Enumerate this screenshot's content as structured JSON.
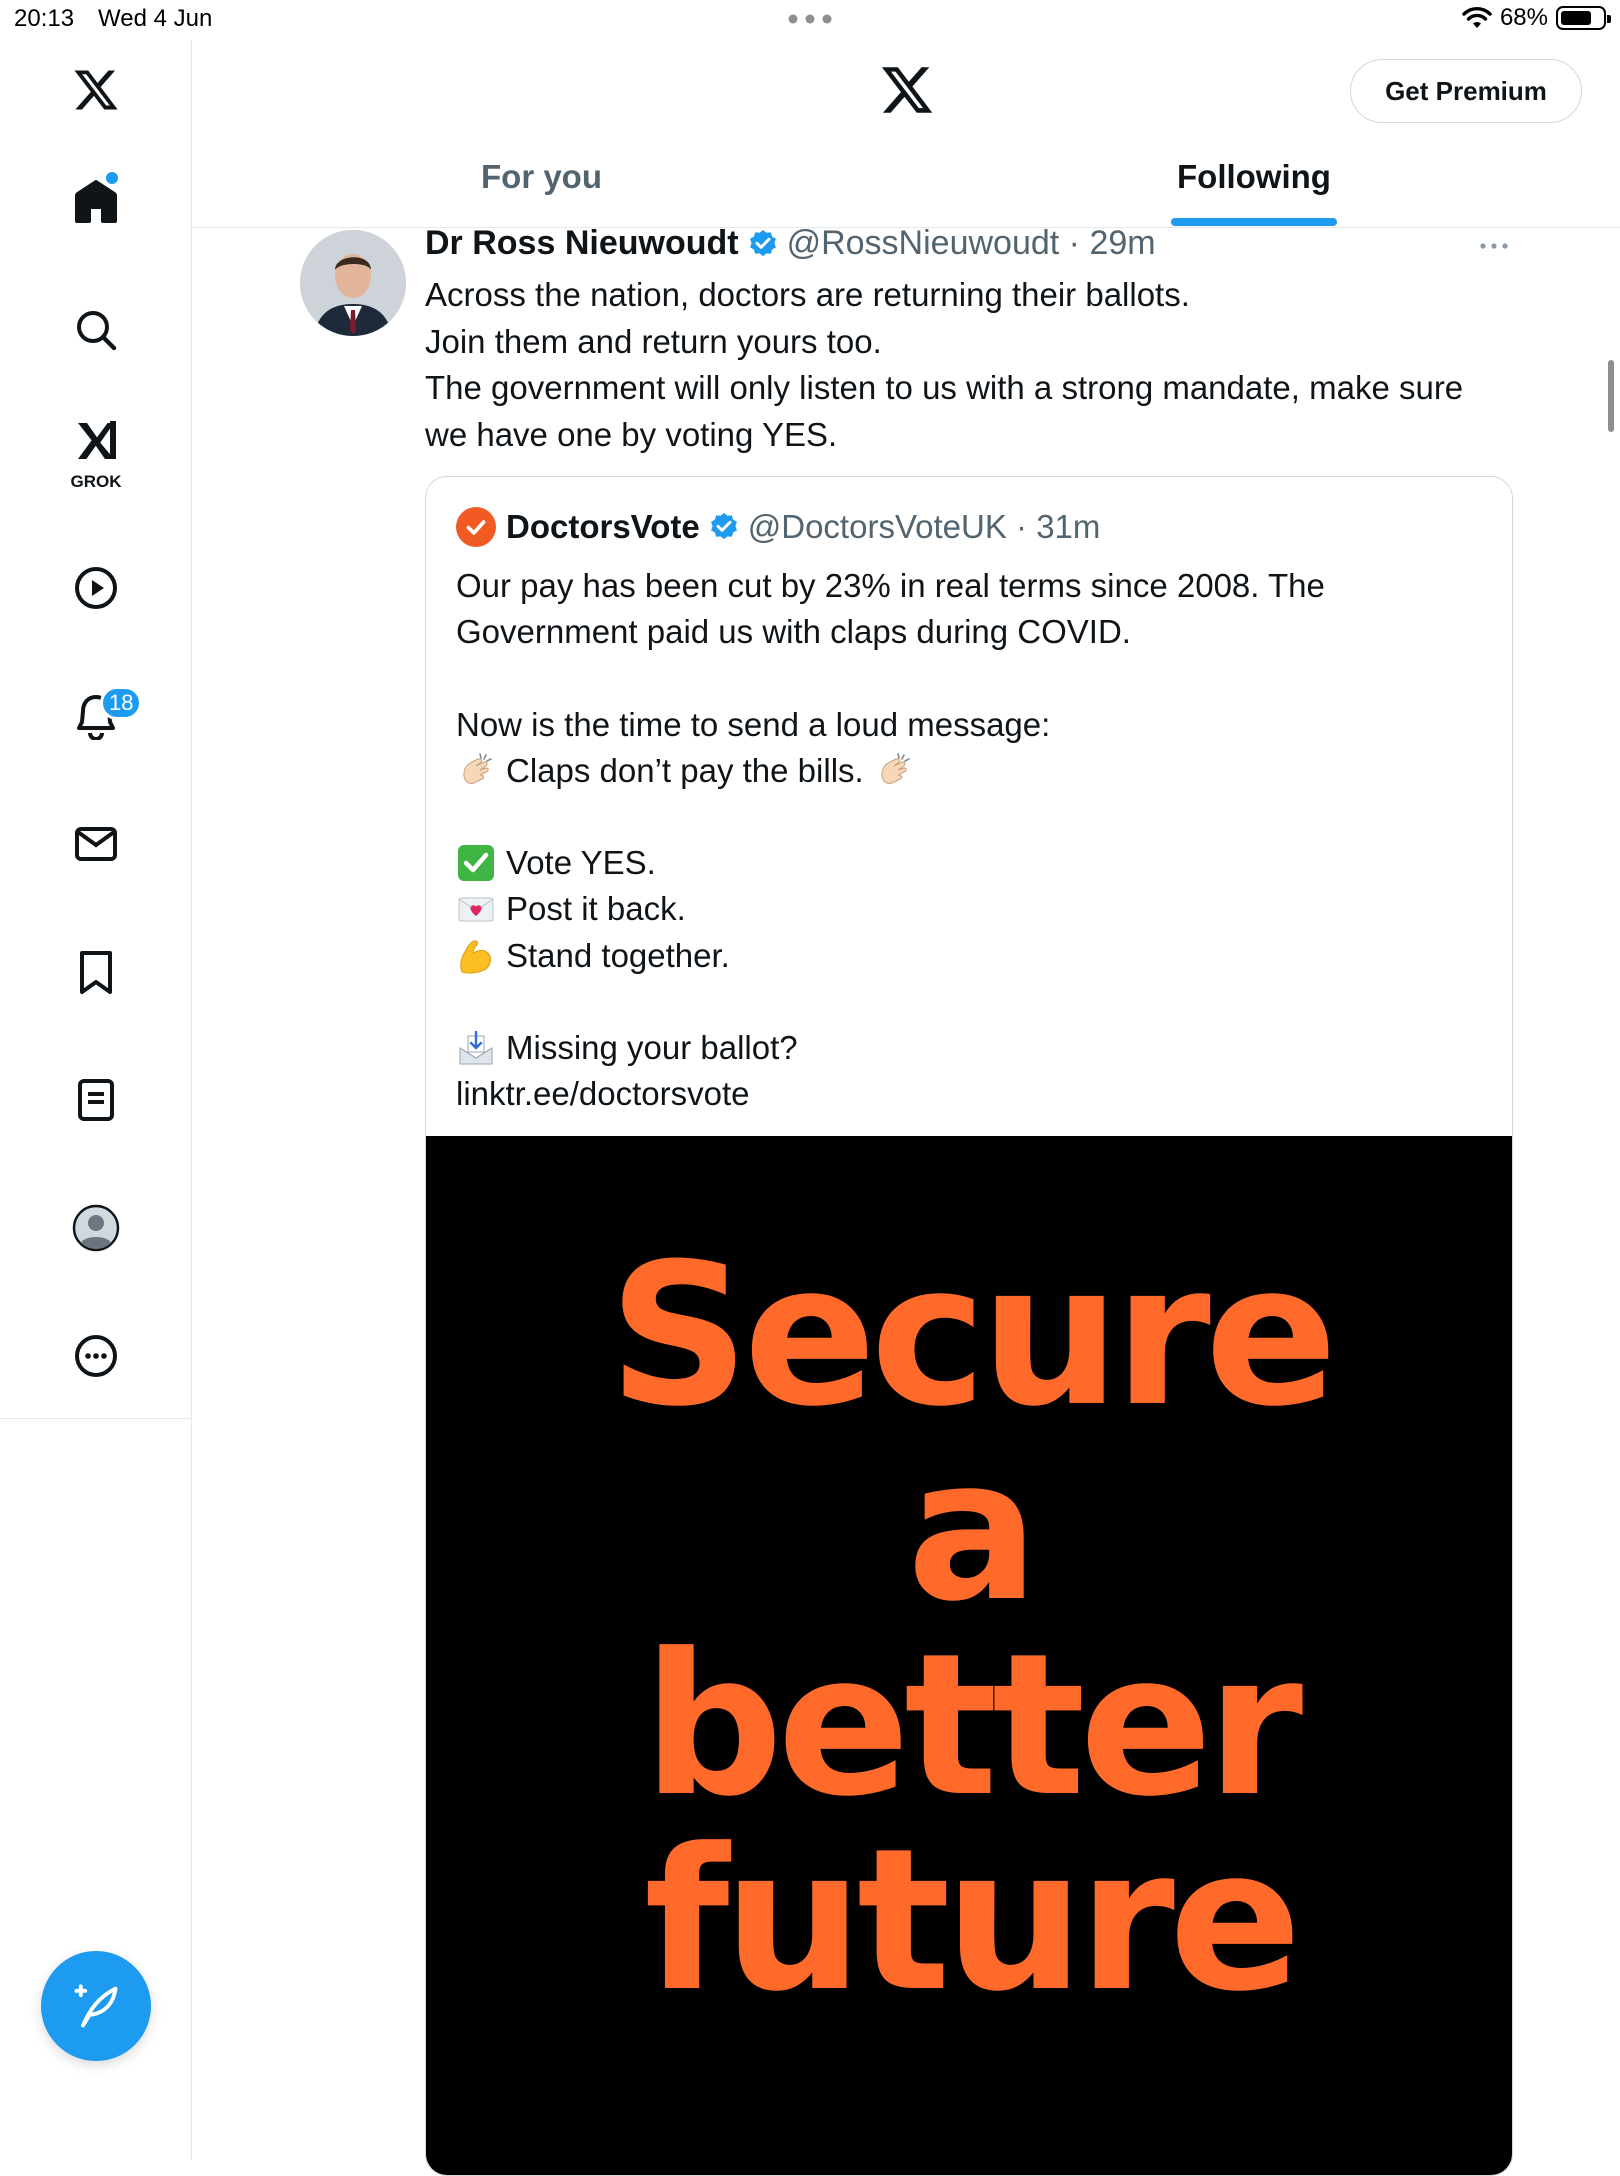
{
  "status_bar": {
    "time": "20:13",
    "date": "Wed 4 Jun",
    "battery": "68%"
  },
  "sidebar": {
    "items": [
      {
        "icon": "x-logo-icon"
      },
      {
        "icon": "home-icon"
      },
      {
        "icon": "search-icon"
      },
      {
        "icon": "grok-icon",
        "label": "GROK"
      },
      {
        "icon": "video-icon"
      },
      {
        "icon": "bell-icon",
        "badge": "18"
      },
      {
        "icon": "mail-icon"
      },
      {
        "icon": "bookmark-icon"
      },
      {
        "icon": "lists-icon"
      },
      {
        "icon": "profile-icon"
      },
      {
        "icon": "more-circle-icon"
      }
    ],
    "compose_icon": "compose-feather-icon"
  },
  "header": {
    "premium_label": "Get Premium",
    "tabs": [
      {
        "label": "For you",
        "active": false
      },
      {
        "label": "Following",
        "active": true
      }
    ]
  },
  "tweet": {
    "author_name": "Dr Ross Nieuwoudt",
    "handle": "@RossNieuwoudt",
    "time": "29m",
    "lines": [
      "Across the nation, doctors are returning their ballots.",
      "Join them and return yours too.",
      "The government will only listen to us with a strong mandate, make sure",
      "we have one by voting YES."
    ],
    "quote": {
      "author_name": "DoctorsVote",
      "handle": "@DoctorsVoteUK",
      "time": "31m",
      "lines": [
        "Our pay has been cut by 23% in real terms since 2008. The",
        "Government paid us with claps during COVID.",
        "",
        "Now is the time to send a loud message:",
        "Claps don’t pay the bills.",
        "",
        "Vote YES.",
        "Post it back.",
        "Stand together.",
        "",
        "Missing your ballot?",
        "linktr.ee/doctorsvote"
      ],
      "image_words": [
        "Secure",
        "a",
        "better",
        "future"
      ]
    }
  },
  "colors": {
    "accent": "#1d9bf0",
    "text": "#0f1419",
    "muted": "#536471",
    "image_text": "#ff6a2b"
  }
}
